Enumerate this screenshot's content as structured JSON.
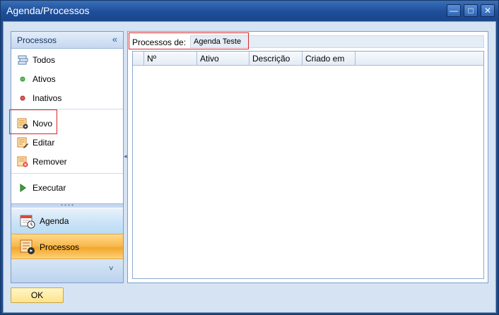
{
  "window": {
    "title": "Agenda/Processos",
    "controls": {
      "minimize": "—",
      "maximize": "□",
      "close": "✕"
    }
  },
  "nav": {
    "header": "Processos",
    "collapse_glyph": "«",
    "filters": [
      {
        "label": "Todos",
        "icon": "list-icon"
      },
      {
        "label": "Ativos",
        "icon": "green-dot-icon"
      },
      {
        "label": "Inativos",
        "icon": "red-dot-icon"
      }
    ],
    "actions": [
      {
        "label": "Novo",
        "icon": "new-process-icon"
      },
      {
        "label": "Editar",
        "icon": "edit-process-icon"
      },
      {
        "label": "Remover",
        "icon": "remove-process-icon"
      }
    ],
    "run": {
      "label": "Executar",
      "icon": "play-icon"
    },
    "groups": [
      {
        "label": "Agenda",
        "icon": "calendar-clock-icon"
      },
      {
        "label": "Processos",
        "icon": "process-icon",
        "selected": true
      }
    ],
    "footer_chevron": "˅"
  },
  "content": {
    "processos_label": "Processos de:",
    "processos_value": "Agenda Teste",
    "columns": [
      "Nº",
      "Ativo",
      "Descrição",
      "Criado em"
    ]
  },
  "buttons": {
    "ok": "OK"
  },
  "colors": {
    "window_blue": "#1f4a8a",
    "client_bg": "#d5e3f3",
    "selected_group": "#f4a62a",
    "highlight_red": "#d7262c"
  }
}
